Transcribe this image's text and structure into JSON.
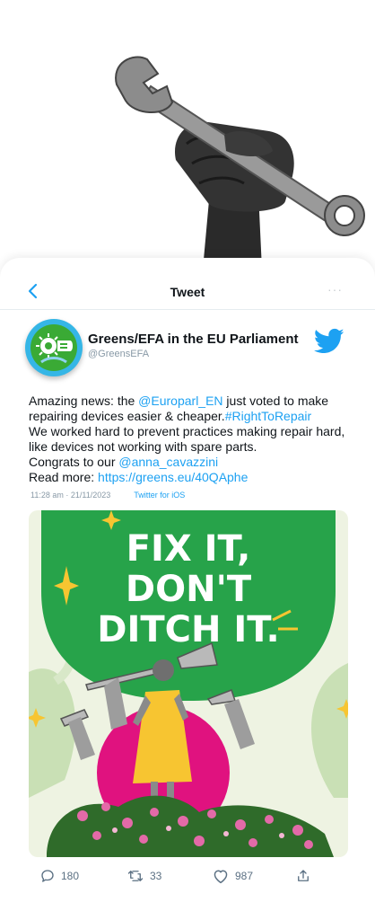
{
  "header": {
    "title": "Tweet",
    "more": "···"
  },
  "author": {
    "display_name": "Greens/EFA in the EU Parliament",
    "handle": "@GreensEFA"
  },
  "tweet": {
    "seg1": "Amazing news: the ",
    "mention1": "@Europarl_EN",
    "seg2": " just voted to make repairing devices easier & cheaper.",
    "hashtag": "#RightToRepair",
    "line2": "We worked hard to prevent practices making repair hard, like devices not working with spare parts.",
    "seg3": "Congrats to our ",
    "mention2": "@anna_cavazzini",
    "seg4": "Read more: ",
    "url": "https://greens.eu/40QAphe"
  },
  "meta": {
    "timestamp": "11:28 am · 21/11/2023",
    "source": "Twitter for iOS"
  },
  "poster": {
    "line1": "FIX IT,",
    "line2": "DON'T",
    "line3": "DITCH IT."
  },
  "actions": {
    "replies": "180",
    "retweets": "33",
    "likes": "987"
  },
  "colors": {
    "link": "#1da1f2",
    "poster_green": "#27a34a",
    "poster_pink": "#e0127f",
    "poster_yellow": "#f7c531",
    "avatar_ring": "#35b6e6"
  }
}
